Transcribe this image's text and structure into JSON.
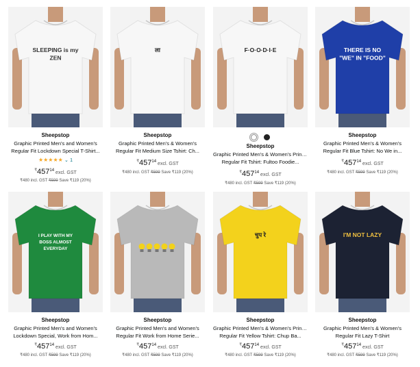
{
  "products": [
    {
      "brand": "Sheepstop",
      "title1": "Graphic Printed Men's and Women's",
      "title2": "Regular Fit Lockdown Special T-Shirt...",
      "stars": "★★★★★",
      "rating_count": "1",
      "currency": "₹",
      "price_whole": "457",
      "price_fraction": "14",
      "excl": "excl. GST",
      "incl_price": "₹480 incl. GST",
      "mrp": "₹599",
      "save": "Save ₹119 (20%)",
      "shirt_color": "#f7f7f7",
      "print_text": "SLEEPING is my ZEN",
      "print_color": "#333333"
    },
    {
      "brand": "Sheepstop",
      "title1": "Graphic Printed Men's & Women's",
      "title2": "Regular Fit Medium Size Tshirt: Ch...",
      "currency": "₹",
      "price_whole": "457",
      "price_fraction": "14",
      "excl": "excl. GST",
      "incl_price": "₹480 incl. GST",
      "mrp": "₹599",
      "save": "Save ₹119 (20%)",
      "shirt_color": "#f7f7f7",
      "print_text": "ला",
      "print_color": "#222222"
    },
    {
      "brand": "Sheepstop",
      "title1": "Graphic Printed Men's & Women's Printed",
      "title2": "Regular Fit Tshirt: Fultoo Foodie...",
      "currency": "₹",
      "price_whole": "457",
      "price_fraction": "14",
      "excl": "excl. GST",
      "incl_price": "₹480 incl. GST",
      "mrp": "₹599",
      "save": "Save ₹119 (20%)",
      "shirt_color": "#f7f7f7",
      "print_text": "F·O·O·D·I·E",
      "print_color": "#222222",
      "swatches": [
        "#ffffff",
        "#222222"
      ]
    },
    {
      "brand": "Sheepstop",
      "title1": "Graphic Printed Men's & Women's",
      "title2": "Regular Fit Blue Tshirt: No We in...",
      "currency": "₹",
      "price_whole": "457",
      "price_fraction": "14",
      "excl": "excl. GST",
      "incl_price": "₹480 incl. GST",
      "mrp": "₹599",
      "save": "Save ₹119 (20%)",
      "shirt_color": "#1f3fa8",
      "print_text": "THERE IS NO \"WE\" IN \"FOOD\"",
      "print_color": "#ffffff"
    },
    {
      "brand": "Sheepstop",
      "title1": "Graphic Printed Men's and Women's",
      "title2": "Lockdown Special, Work from Hom...",
      "currency": "₹",
      "price_whole": "457",
      "price_fraction": "14",
      "excl": "excl. GST",
      "incl_price": "₹480 incl. GST",
      "mrp": "₹599",
      "save": "Save ₹119 (20%)",
      "shirt_color": "#1f8a3e",
      "print_text": "I PLAY WITH MY BOSS ALMOST EVERYDAY",
      "print_color": "#ffffff"
    },
    {
      "brand": "Sheepstop",
      "title1": "Graphic Printed Men's and Women's",
      "title2": "Regular Fit Work from Home Serie...",
      "currency": "₹",
      "price_whole": "457",
      "price_fraction": "14",
      "excl": "excl. GST",
      "incl_price": "₹480 incl. GST",
      "mrp": "₹599",
      "save": "Save ₹119 (20%)",
      "shirt_color": "#b9b9b9",
      "print_text": "",
      "print_color": "#f2d21b"
    },
    {
      "brand": "Sheepstop",
      "title1": "Graphic Printed Men's & Women's Printed",
      "title2": "Regular Fit Yellow Tshirt: Chup Ba...",
      "currency": "₹",
      "price_whole": "457",
      "price_fraction": "14",
      "excl": "excl. GST",
      "incl_price": "₹480 incl. GST",
      "mrp": "₹599",
      "save": "Save ₹119 (20%)",
      "shirt_color": "#f3d21c",
      "print_text": "चुप रे",
      "print_color": "#222222"
    },
    {
      "brand": "Sheepstop",
      "title1": "Graphic Printed Men's & Women's",
      "title2": "Regular Fit Lazy T-Shirt",
      "currency": "₹",
      "price_whole": "457",
      "price_fraction": "14",
      "excl": "excl. GST",
      "incl_price": "₹480 incl. GST",
      "mrp": "₹599",
      "save": "Save ₹119 (20%)",
      "shirt_color": "#1c2233",
      "print_text": "I'M NOT LAZY",
      "print_color": "#f0c040"
    }
  ]
}
